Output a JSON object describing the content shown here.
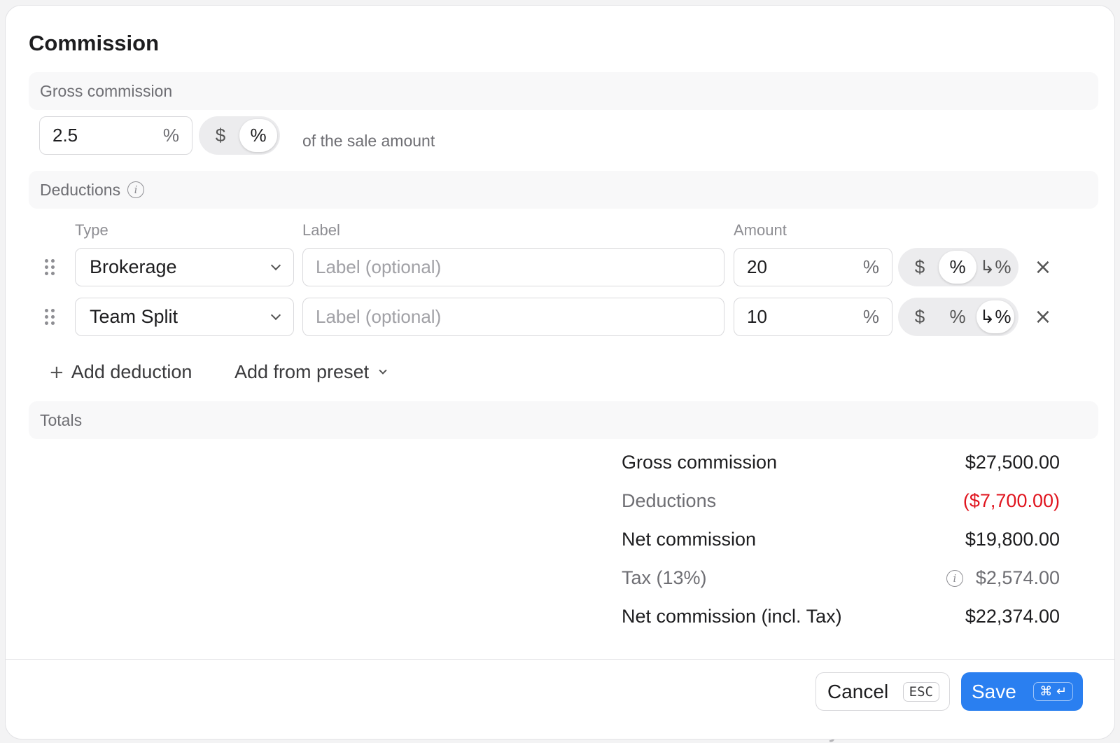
{
  "background": {
    "partial_text": "No tasks yet"
  },
  "modal": {
    "title": "Commission",
    "gross": {
      "section_label": "Gross commission",
      "value": "2.5",
      "suffix": "%",
      "toggle": {
        "options": [
          "$",
          "%"
        ],
        "selected": "%"
      },
      "hint": "of the sale amount"
    },
    "deductions": {
      "section_label": "Deductions",
      "columns": {
        "type": "Type",
        "label": "Label",
        "amount": "Amount"
      },
      "rows": [
        {
          "type": "Brokerage",
          "label_placeholder": "Label (optional)",
          "amount": "20",
          "suffix": "%",
          "toggle": [
            "$",
            "%",
            "↳%"
          ],
          "selected": "%"
        },
        {
          "type": "Team Split",
          "label_placeholder": "Label (optional)",
          "amount": "10",
          "suffix": "%",
          "toggle": [
            "$",
            "%",
            "↳%"
          ],
          "selected": "↳%"
        }
      ],
      "add_deduction": "Add deduction",
      "add_from_preset": "Add from preset"
    },
    "totals": {
      "section_label": "Totals",
      "rows": [
        {
          "label": "Gross commission",
          "value": "$27,500.00"
        },
        {
          "label": "Deductions",
          "value": "($7,700.00)"
        },
        {
          "label": "Net commission",
          "value": "$19,800.00"
        },
        {
          "label": "Tax (13%)",
          "value": "$2,574.00"
        },
        {
          "label": "Net commission (incl. Tax)",
          "value": "$22,374.00"
        }
      ]
    },
    "footer": {
      "cancel_label": "Cancel",
      "cancel_shortcut": "ESC",
      "save_label": "Save",
      "save_shortcut": "⌘ ↵"
    }
  },
  "colors": {
    "accent": "#2a7ff0",
    "negative": "#e0141e",
    "muted": "#6e6e73"
  }
}
